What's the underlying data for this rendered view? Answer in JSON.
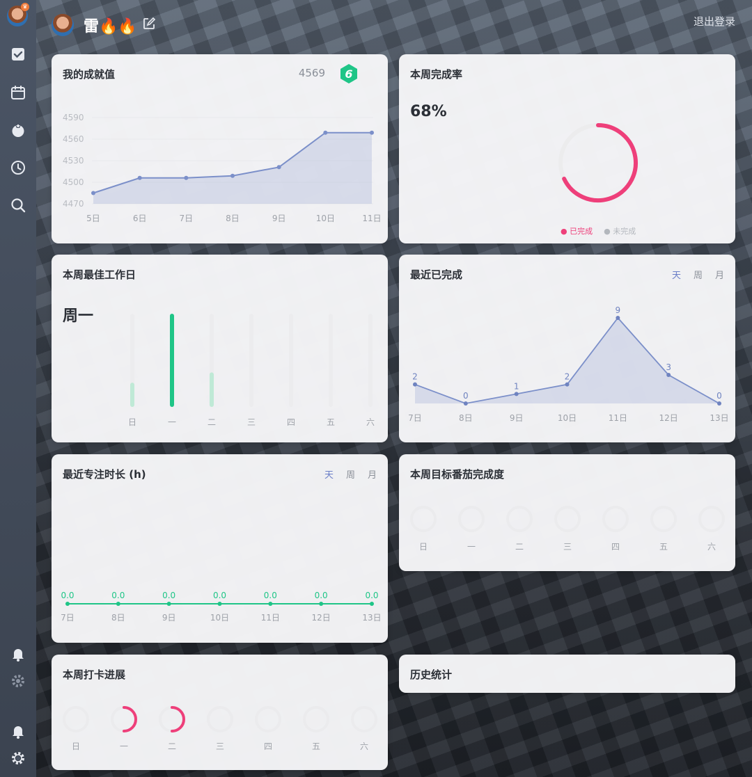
{
  "user": {
    "name": "雷🔥🔥",
    "logout_label": "退出登录"
  },
  "sidebar": {
    "icons": [
      "avatar",
      "check-square-icon",
      "calendar-icon",
      "pomodoro-icon",
      "clock-icon",
      "search-icon",
      "bell-icon",
      "gear-icon",
      "bell-icon",
      "gear-icon"
    ]
  },
  "achievement": {
    "title": "我的成就值",
    "value": "4569",
    "level": "6",
    "chart_data": {
      "type": "area",
      "categories": [
        "5日",
        "6日",
        "7日",
        "8日",
        "9日",
        "10日",
        "11日"
      ],
      "values": [
        4485,
        4506,
        4506,
        4509,
        4521,
        4569,
        4569
      ],
      "yticks": [
        "4590",
        "4560",
        "4530",
        "4500",
        "4470"
      ],
      "ylim": [
        4470,
        4590
      ],
      "color": "#7b8fc9"
    }
  },
  "weekly_rate": {
    "title": "本周完成率",
    "value": "68%",
    "chart_data": {
      "type": "pie",
      "completed": 68,
      "remaining": 32
    },
    "legend_done": "已完成",
    "legend_undone": "未完成",
    "done_color": "#ee3f7a",
    "undone_color": "#dcdcdc"
  },
  "best_day": {
    "title": "本周最佳工作日",
    "value": "周一",
    "chart_data": {
      "type": "bar",
      "categories": [
        "日",
        "一",
        "二",
        "三",
        "四",
        "五",
        "六"
      ],
      "values": [
        0.26,
        1.0,
        0.37,
        0,
        0,
        0,
        0
      ]
    },
    "accent": "#1fc587"
  },
  "recent_done": {
    "title": "最近已完成",
    "tabs": [
      "天",
      "周",
      "月"
    ],
    "chart_data": {
      "type": "area",
      "categories": [
        "7日",
        "8日",
        "9日",
        "10日",
        "11日",
        "12日",
        "13日"
      ],
      "values": [
        2,
        0,
        1,
        2,
        9,
        3,
        0
      ],
      "ylim": [
        0,
        9
      ]
    }
  },
  "focus": {
    "title": "最近专注时长 (h)",
    "tabs": [
      "天",
      "周",
      "月"
    ],
    "chart_data": {
      "type": "line",
      "categories": [
        "7日",
        "8日",
        "9日",
        "10日",
        "11日",
        "12日",
        "13日"
      ],
      "values": [
        0.0,
        0.0,
        0.0,
        0.0,
        0.0,
        0.0,
        0.0
      ],
      "labels": [
        "0.0",
        "0.0",
        "0.0",
        "0.0",
        "0.0",
        "0.0",
        "0.0"
      ]
    },
    "accent": "#1fc587"
  },
  "tomato": {
    "title": "本周目标番茄完成度",
    "days": [
      "日",
      "一",
      "二",
      "三",
      "四",
      "五",
      "六"
    ]
  },
  "checkin": {
    "title": "本周打卡进展",
    "days": [
      "日",
      "一",
      "二",
      "三",
      "四",
      "五",
      "六"
    ],
    "progress": [
      0,
      0.5,
      0.5,
      0,
      0,
      0,
      0
    ]
  },
  "history": {
    "title": "历史统计"
  }
}
